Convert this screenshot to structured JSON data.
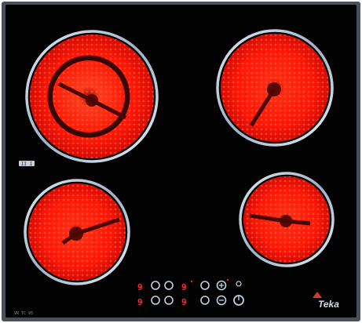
{
  "cooktop": {
    "model_label": "VR TC 95",
    "badge_label": "II I",
    "brand": "Teka",
    "colors": {
      "glass": "#020203",
      "frame": "#4a4f5c",
      "ring": "#b9c6d6",
      "hot": "#ff1a0d",
      "display": "#ff2020"
    },
    "zones": [
      {
        "name": "front-left-dual-zone",
        "type": "dual",
        "state": "on"
      },
      {
        "name": "back-right-zone",
        "type": "single",
        "state": "on"
      },
      {
        "name": "front-left-zone",
        "type": "single",
        "state": "on"
      },
      {
        "name": "front-right-zone",
        "type": "single",
        "state": "on"
      }
    ],
    "controls": {
      "displays": [
        "9",
        "9",
        "9",
        "9"
      ],
      "touch_keys": [
        "plus-icon",
        "minus-icon",
        "power-icon",
        "lock-icon"
      ]
    }
  }
}
